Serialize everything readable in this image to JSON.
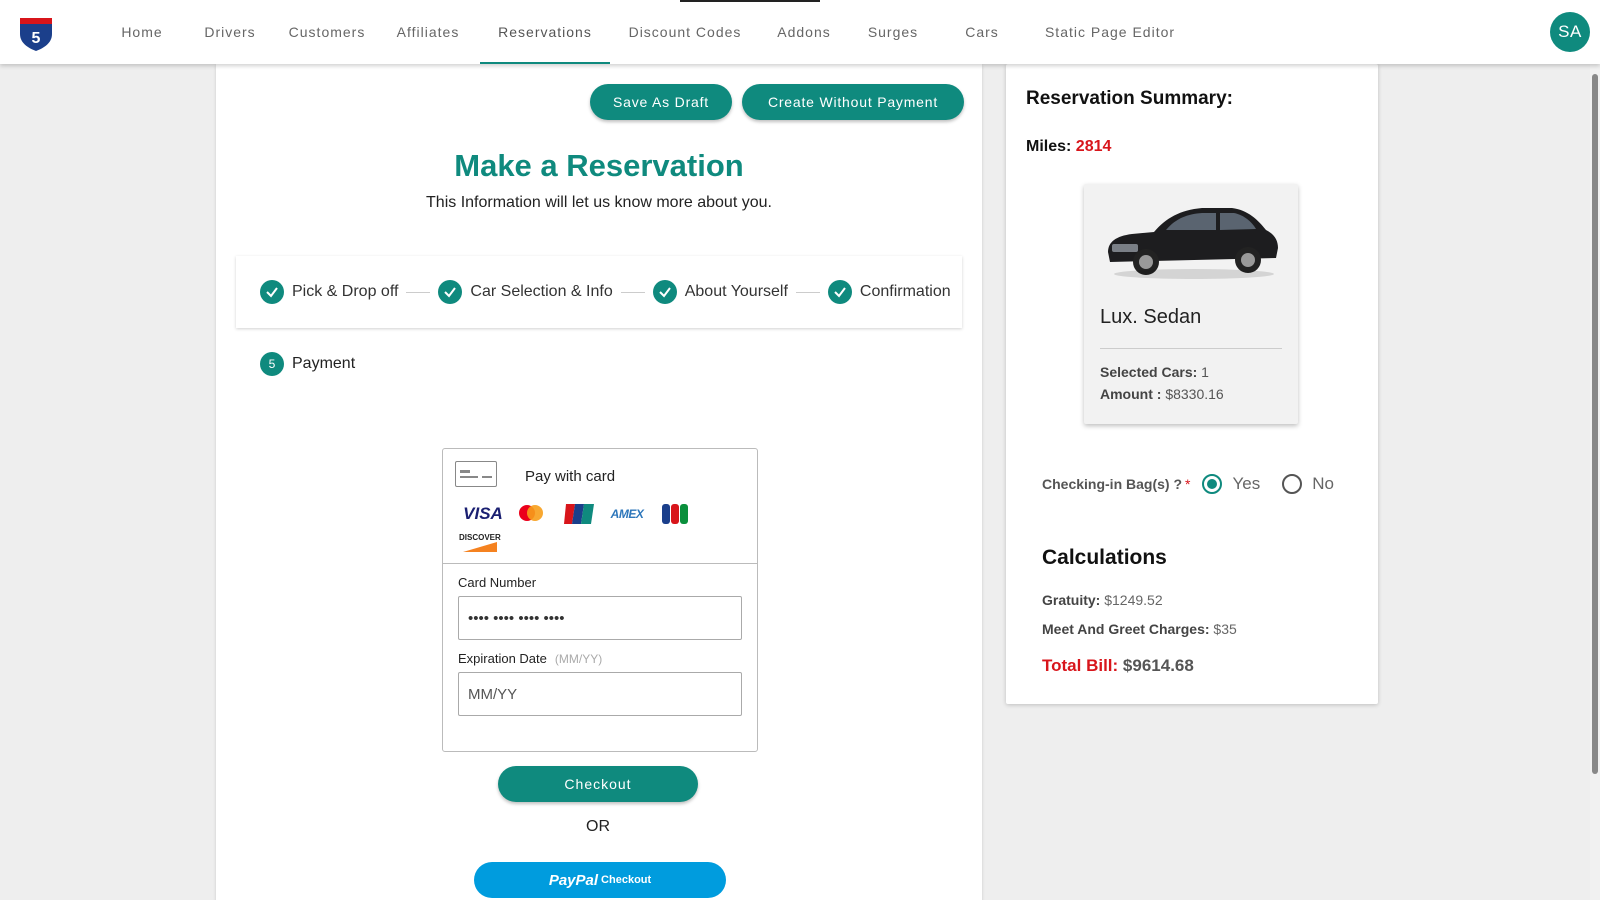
{
  "nav": {
    "items": [
      "Home",
      "Drivers",
      "Customers",
      "Affiliates",
      "Reservations",
      "Discount Codes",
      "Addons",
      "Surges",
      "Cars",
      "Static Page Editor"
    ],
    "active": "Reservations",
    "avatar_initials": "SA"
  },
  "actions": {
    "save_draft": "Save As Draft",
    "create_without_payment": "Create Without Payment"
  },
  "header": {
    "title": "Make a Reservation",
    "subtitle": "This Information will let us know more about you."
  },
  "steps": [
    {
      "label": "Pick & Drop off",
      "completed": true
    },
    {
      "label": "Car Selection & Info",
      "completed": true
    },
    {
      "label": "About Yourself",
      "completed": true
    },
    {
      "label": "Confirmation",
      "completed": true
    }
  ],
  "current_step": {
    "number": "5",
    "label": "Payment"
  },
  "payment": {
    "title": "Pay with card",
    "brands": [
      "VISA",
      "mastercard-icon",
      "unionpay-icon",
      "AMEX",
      "jcb-icon",
      "DISCOVER"
    ],
    "card_number_label": "Card Number",
    "card_number_value": "•••• •••• •••• ••••",
    "expiration_label": "Expiration Date",
    "expiration_hint": "(MM/YY)",
    "expiration_placeholder": "MM/YY",
    "checkout_label": "Checkout",
    "or_label": "OR",
    "paypal_label": "PayPal",
    "paypal_suffix": "Checkout"
  },
  "summary": {
    "title": "Reservation Summary:",
    "miles_label": "Miles:",
    "miles_value": "2814",
    "car_name": "Lux. Sedan",
    "selected_cars_label": "Selected Cars:",
    "selected_cars_value": "1",
    "amount_label": "Amount :",
    "amount_value": "$8330.16",
    "bags_label": "Checking-in Bag(s) ?",
    "bags_required": "*",
    "bags_yes": "Yes",
    "bags_no": "No",
    "bags_selected": "Yes",
    "calc_title": "Calculations",
    "gratuity_label": "Gratuity:",
    "gratuity_value": "$1249.52",
    "meet_label": "Meet And Greet Charges:",
    "meet_value": "$35",
    "total_label": "Total Bill:",
    "total_value": "$9614.68"
  },
  "colors": {
    "accent": "#0f8a7e",
    "alert": "#d8151b",
    "paypal": "#009cde"
  }
}
